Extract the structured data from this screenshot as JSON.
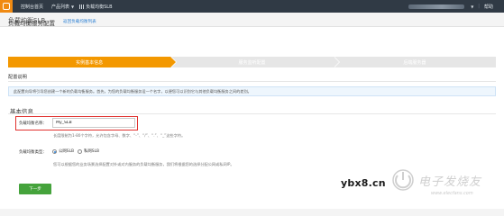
{
  "topbar": {
    "console_home": "控制台首页",
    "product_list": "产品列表",
    "current_product": "负载均衡SLB",
    "right_link": "帮助"
  },
  "page": {
    "header_title": "负载均衡SLB",
    "config_title": "负载均衡服务配置",
    "back_link": "返回负载均衡列表"
  },
  "steps": [
    {
      "label": "实例基本信息",
      "active": true
    },
    {
      "label": "服务监听配置",
      "active": false
    },
    {
      "label": "后端服务器",
      "active": false
    }
  ],
  "config_section": {
    "label": "配置说明",
    "notice": "此配置向导将引导您创建一个新的负载均衡服务。首先，为您的负载均衡服务设一个名字，以便您可以识别它与其他负载均衡服务之间的差别。"
  },
  "basic_info": {
    "title": "基本信息",
    "name_label": "负载均衡名称：",
    "name_value": "My_SLB",
    "name_hint": "长度限制为1-80个字符，允许包含字母、数字、“-”、“/”、“.”、“_”这些字符。",
    "type_label": "负载均衡类型：",
    "type_options": [
      "公网SLB",
      "私网SLB"
    ],
    "type_selected": "公网SLB",
    "type_hint": "您可以根据您的业务场景选择配置对外或对内服务的负载均衡服务，我们将根据您的选择分配公网或私网IP。"
  },
  "actions": {
    "next_label": "下一步"
  },
  "watermark": {
    "url": "ybx8.cn",
    "brand": "电子发烧友",
    "sub": "www.elecfans.com"
  },
  "colors": {
    "topbar": "#303a45",
    "logo": "#f08a12",
    "step_active": "#f39800",
    "step_inactive": "#e6e6e6",
    "highlight_box": "#e0312e",
    "next_button": "#45a33c",
    "link": "#2a7fd3"
  }
}
